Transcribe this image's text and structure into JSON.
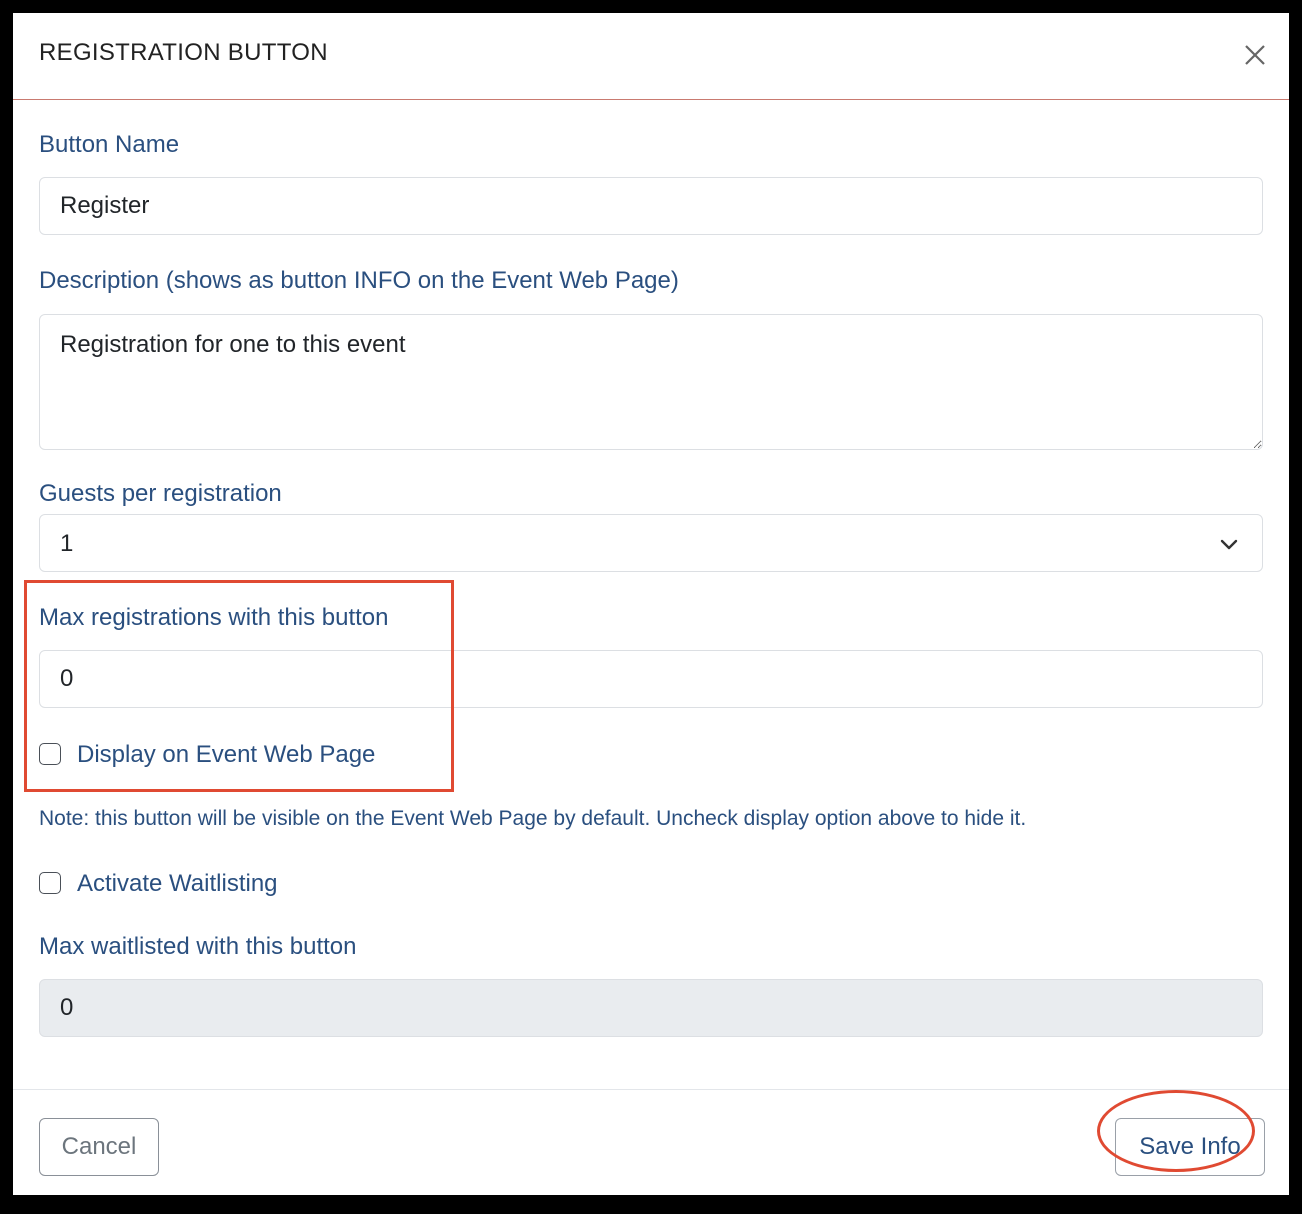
{
  "modal": {
    "title": "REGISTRATION BUTTON"
  },
  "form": {
    "button_name": {
      "label": "Button Name",
      "value": "Register"
    },
    "description": {
      "label": "Description (shows as button INFO on the Event Web Page)",
      "value": "Registration for one to this event"
    },
    "guests": {
      "label": "Guests per registration",
      "value": "1"
    },
    "max_registrations": {
      "label": "Max registrations with this button",
      "value": "0"
    },
    "display_on_web": {
      "label": "Display on Event Web Page",
      "checked": false
    },
    "note": "Note: this button will be visible on the Event Web Page by default. Uncheck display option above to hide it.",
    "waitlisting": {
      "label": "Activate Waitlisting",
      "checked": false
    },
    "max_waitlisted": {
      "label": "Max waitlisted with this button",
      "value": "0"
    }
  },
  "footer": {
    "cancel_label": "Cancel",
    "save_label": "Save Info"
  },
  "icons": {
    "close": "close-icon",
    "chevron": "chevron-down-icon"
  },
  "colors": {
    "label": "#2a4f7f",
    "highlight": "#e04a32",
    "disabled_bg": "#e9ecef"
  }
}
